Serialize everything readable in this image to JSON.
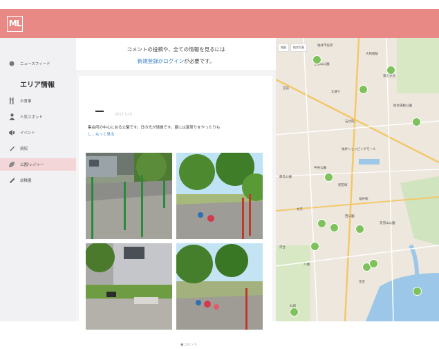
{
  "header": {
    "logo_text": "ML",
    "brand_color": "#e98985"
  },
  "sidebar": {
    "section_title": "エリア情報",
    "news_feed": {
      "label": "ニュースフィード",
      "icon": "circle-icon"
    },
    "items": [
      {
        "label": "お食事",
        "icon": "dining-icon"
      },
      {
        "label": "人気スポット",
        "icon": "person-icon"
      },
      {
        "label": "イベント",
        "icon": "megaphone-icon"
      },
      {
        "label": "病院",
        "icon": "pen-icon"
      },
      {
        "label": "公園/レジャー",
        "icon": "leaf-icon",
        "active": true
      },
      {
        "label": "幼稚園",
        "icon": "pencil-icon"
      }
    ]
  },
  "notice": {
    "line1": "コメントの投稿や、全ての情報を見るには",
    "link_text": "新規登録かログイン",
    "line2_suffix": "が必要です。"
  },
  "post": {
    "date": "2017.5.15",
    "description": "集会所の中心にある公園です。日の光が綺麗です。夏には夏祭りをやったりも",
    "more_link": "し…もっと見る",
    "comment_label": "コメント"
  },
  "map": {
    "tabs": [
      "地図",
      "航空写真"
    ],
    "labels": [
      "福井市役所",
      "上島山公園",
      "大和田駅",
      "富士見台",
      "宮前",
      "北通り",
      "総合運動公園",
      "石伏院",
      "福井ショッピングモール",
      "中央公園",
      "藤島公園",
      "新田塚",
      "福井駅",
      "文京",
      "西公園",
      "足羽山公園",
      "河合",
      "八幡",
      "花堂",
      "丸岡"
    ],
    "pin_color": "#7dc25c"
  }
}
